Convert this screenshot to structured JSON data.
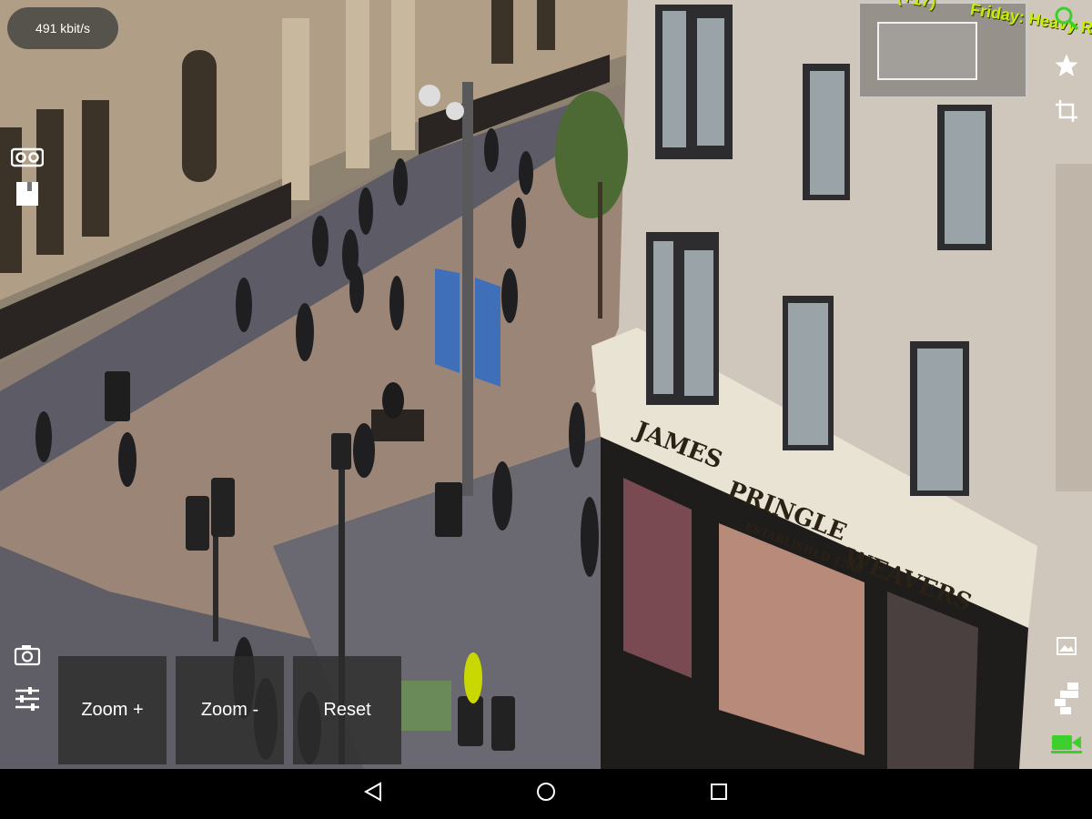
{
  "status": {
    "bitrate": "491 kbit/s"
  },
  "camera_overlay": {
    "ticker_text_1": "Friday: Heavy R",
    "ticker_text_2": "(+17)"
  },
  "scene": {
    "storefront_sign_line1": "JAMES",
    "storefront_sign_line2": "PRINGLE",
    "storefront_sign_line3": "WEAVERS",
    "storefront_sign_established": "ESTABLISHED 1780"
  },
  "controls": {
    "zoom_in_label": "Zoom +",
    "zoom_out_label": "Zoom -",
    "reset_label": "Reset"
  },
  "icons": {
    "left": [
      "vr-icon",
      "bookmark-icon",
      "camera-icon",
      "settings-sliders-icon"
    ],
    "right": [
      "search-icon",
      "star-icon",
      "crop-icon",
      "image-icon",
      "grid-icon",
      "video-camera-icon"
    ],
    "nav": [
      "back-icon",
      "home-icon",
      "recent-apps-icon"
    ]
  },
  "colors": {
    "overlay_text": "#c7f000",
    "active_camera_icon": "#3ccf2e"
  }
}
